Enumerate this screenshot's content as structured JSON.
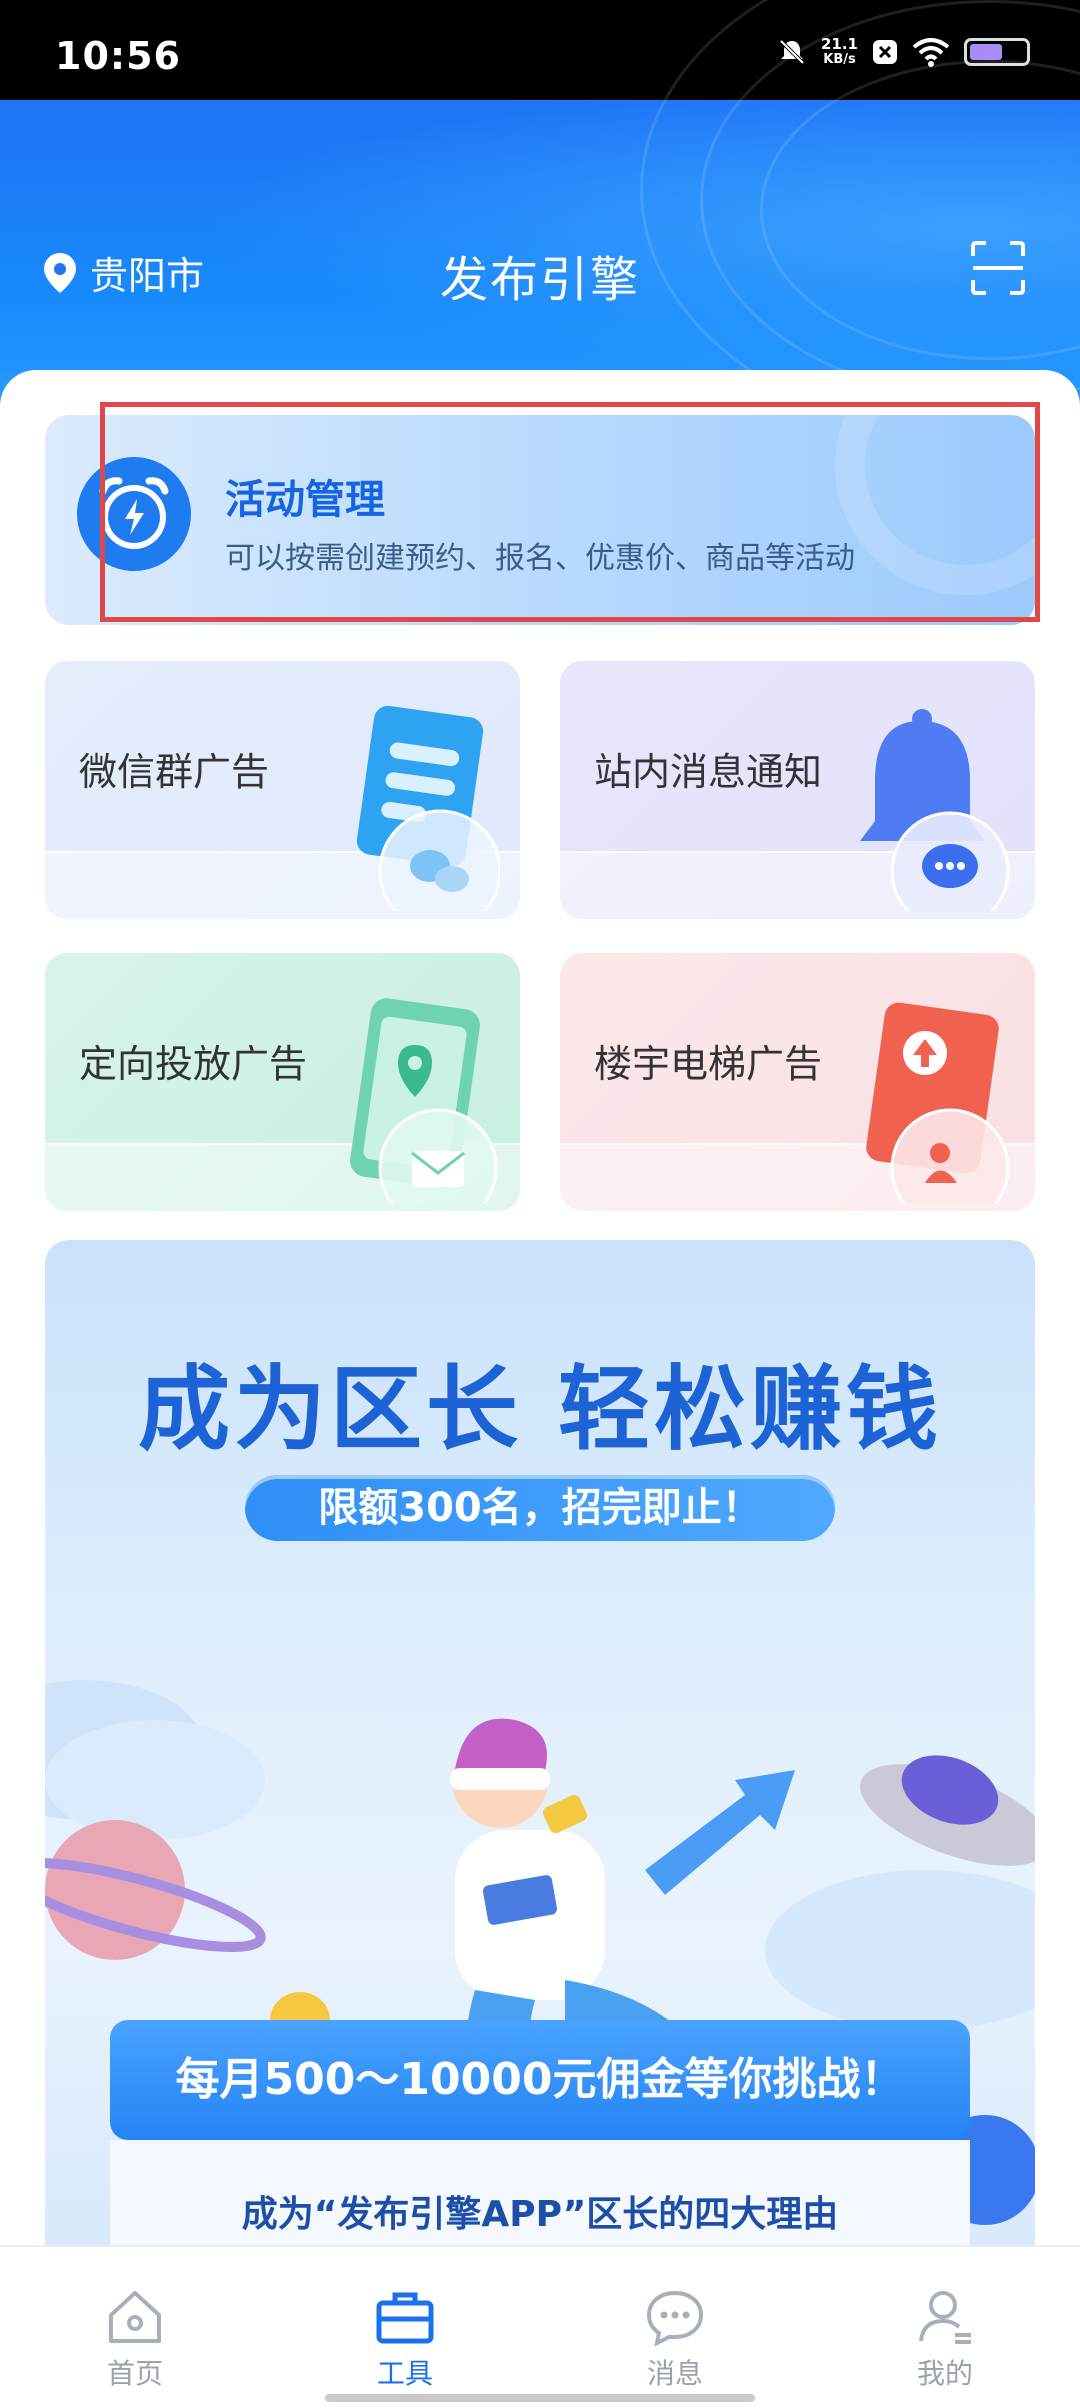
{
  "status_bar": {
    "time": "10:56",
    "net_speed_value": "21.1",
    "net_speed_unit": "KB/s",
    "icons": [
      "mute-icon",
      "close-app-icon",
      "wifi-icon",
      "battery-icon"
    ]
  },
  "header": {
    "location": "贵阳市",
    "title": "发布引擎",
    "scan_icon": "scan-icon"
  },
  "activity_card": {
    "title": "活动管理",
    "description": "可以按需创建预约、报名、优惠价、商品等活动",
    "icon": "alarm-clock-icon"
  },
  "tool_cards": [
    {
      "label": "微信群广告",
      "icon": "wechat-document-icon"
    },
    {
      "label": "站内消息通知",
      "icon": "bell-icon"
    },
    {
      "label": "定向投放广告",
      "icon": "phone-map-icon"
    },
    {
      "label": "楼宇电梯广告",
      "icon": "elevator-icon"
    }
  ],
  "banner": {
    "headline": "成为区长 轻松赚钱",
    "pill": "限额300名，招完即止！",
    "commission": "每月500～10000元佣金等你挑战！",
    "reasons_title": "成为“发布引擎APP”区长的四大理由"
  },
  "tabbar": {
    "tabs": [
      {
        "label": "首页",
        "icon": "home-icon",
        "active": false
      },
      {
        "label": "工具",
        "icon": "toolbox-icon",
        "active": true
      },
      {
        "label": "消息",
        "icon": "message-icon",
        "active": false
      },
      {
        "label": "我的",
        "icon": "profile-icon",
        "active": false
      }
    ]
  },
  "colors": {
    "brand_blue": "#1b70ec",
    "highlight_red": "#e04848"
  }
}
